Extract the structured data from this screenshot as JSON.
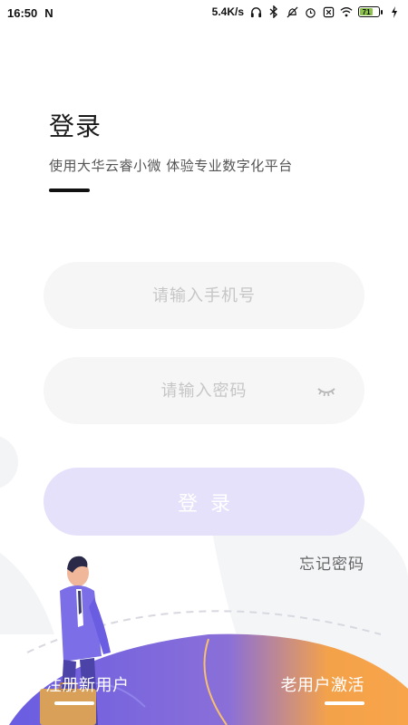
{
  "status_bar": {
    "time": "16:50",
    "network_speed": "5.4K/s",
    "battery_level": "71",
    "icons": [
      "notification-n-icon",
      "headphones-icon",
      "bluetooth-icon",
      "mute-icon",
      "alarm-icon",
      "sim-icon",
      "wifi-icon",
      "battery-icon",
      "charging-icon"
    ]
  },
  "header": {
    "title": "登录",
    "subtitle": "使用大华云睿小微 体验专业数字化平台"
  },
  "form": {
    "phone_placeholder": "请输入手机号",
    "password_placeholder": "请输入密码",
    "login_label": "登录",
    "forgot_label": "忘记密码"
  },
  "bottom": {
    "register_label": "注册新用户",
    "activate_label": "老用户激活"
  },
  "colors": {
    "button_bg": "#e6e1fb",
    "field_bg": "#f6f6f6",
    "purple": "#6b5ce0",
    "orange": "#f6a24a"
  }
}
